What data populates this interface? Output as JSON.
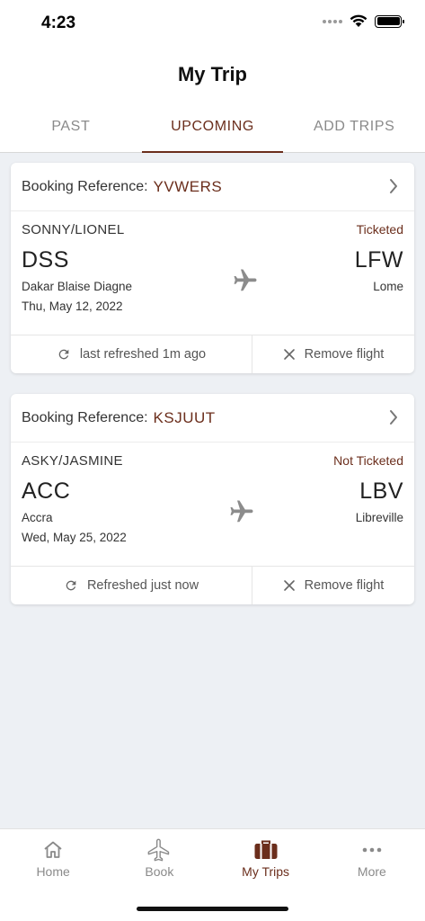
{
  "status_bar": {
    "time": "4:23"
  },
  "header": {
    "title": "My Trip"
  },
  "tabs": [
    {
      "label": "PAST",
      "active": false
    },
    {
      "label": "UPCOMING",
      "active": true
    },
    {
      "label": "ADD TRIPS",
      "active": false
    }
  ],
  "bookings": [
    {
      "reference_label": "Booking Reference:",
      "reference_code": "YVWERS",
      "passenger": "SONNY/LIONEL",
      "ticket_status": "Ticketed",
      "origin_code": "DSS",
      "origin_city": "Dakar Blaise Diagne",
      "destination_code": "LFW",
      "destination_city": "Lome",
      "date": "Thu, May 12, 2022",
      "refresh_text": "last refreshed  1m ago",
      "remove_label": "Remove flight"
    },
    {
      "reference_label": "Booking Reference:",
      "reference_code": "KSJUUT",
      "passenger": "ASKY/JASMINE",
      "ticket_status": "Not Ticketed",
      "origin_code": "ACC",
      "origin_city": "Accra",
      "destination_code": "LBV",
      "destination_city": "Libreville",
      "date": "Wed, May 25, 2022",
      "refresh_text": "Refreshed just now",
      "remove_label": "Remove flight"
    }
  ],
  "bottom_nav": [
    {
      "label": "Home",
      "icon": "home-icon",
      "active": false
    },
    {
      "label": "Book",
      "icon": "airplane-icon",
      "active": false
    },
    {
      "label": "My Trips",
      "icon": "suitcase-icon",
      "active": true
    },
    {
      "label": "More",
      "icon": "more-dots-icon",
      "active": false
    }
  ],
  "colors": {
    "accent": "#6b2e1c",
    "background": "#edf0f4",
    "inactive": "#8a8a8a"
  }
}
